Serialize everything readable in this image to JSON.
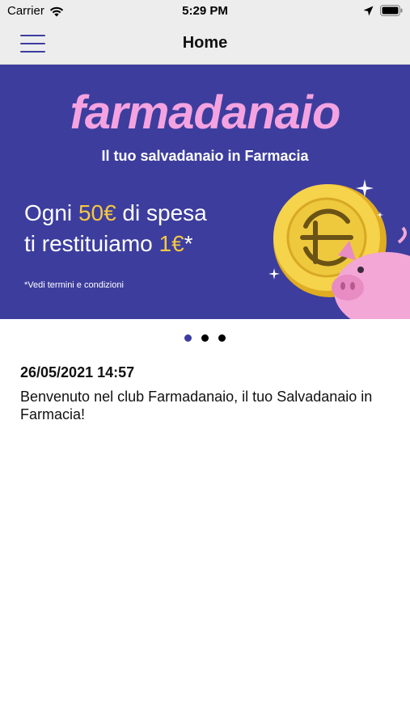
{
  "status_bar": {
    "carrier": "Carrier",
    "time": "5:29 PM",
    "icons": [
      "wifi-icon",
      "location-icon",
      "battery-icon"
    ]
  },
  "nav": {
    "title": "Home",
    "menu_icon": "hamburger-menu-icon"
  },
  "banner": {
    "brand": "farmadanaio",
    "tagline": "Il tuo salvadanaio in Farmacia",
    "promo_line_1_prefix": "Ogni ",
    "promo_line_1_amount": "50€",
    "promo_line_1_suffix": " di spesa",
    "promo_line_2_prefix": "ti restituiamo ",
    "promo_line_2_amount": "1€",
    "promo_line_2_suffix": "*",
    "terms": "*Vedi termini e condizioni",
    "colors": {
      "background": "#3d3d9e",
      "brand": "#f4a3e0",
      "highlight": "#f5c842"
    }
  },
  "carousel": {
    "page_count": 3,
    "active_index": 0
  },
  "message": {
    "date": "26/05/2021 14:57",
    "text": "Benvenuto nel club Farmadanaio, il tuo Salvadanaio in Farmacia!"
  },
  "accent_color": "#3c3ca0"
}
